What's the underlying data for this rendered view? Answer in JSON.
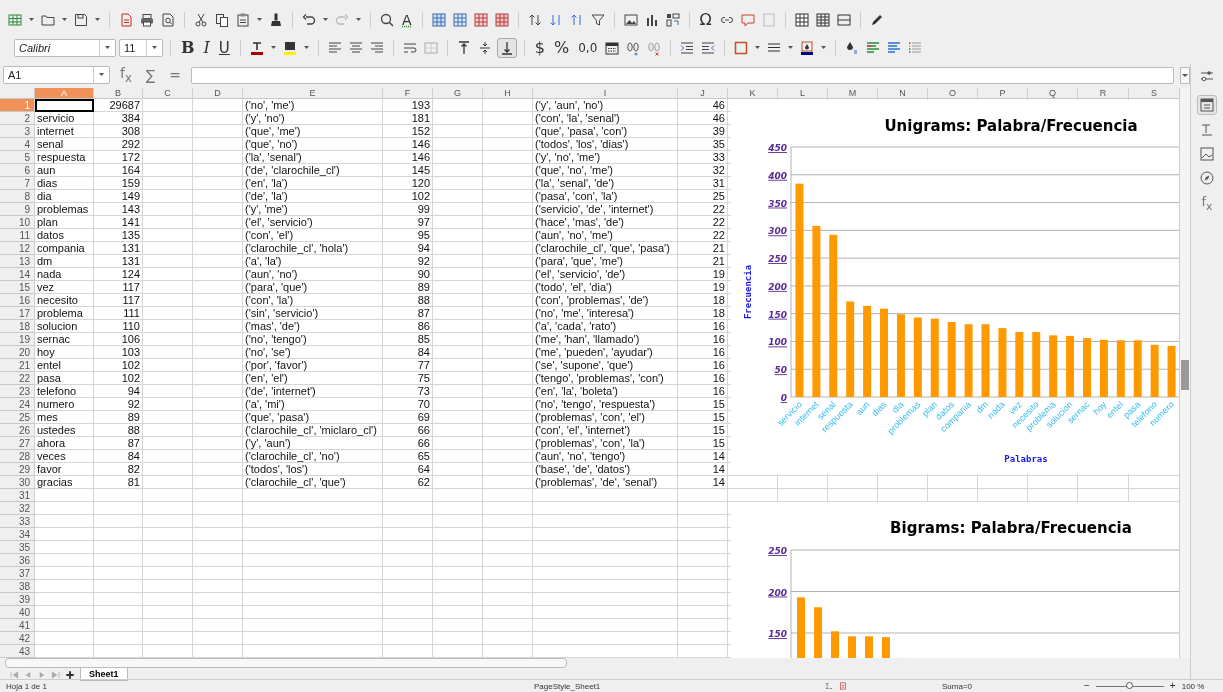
{
  "toolbar": {
    "spelling": "A",
    "special_character": "Ω",
    "font_name": "Calibri",
    "font_size": "11",
    "bold": "B",
    "italic": "I",
    "underline": "U",
    "align_bottom_on": true,
    "currency": "$",
    "percent": "%",
    "number_format": "0,0"
  },
  "formula_bar": {
    "name_box": "A1",
    "function_wizard": "f$_{x}$",
    "sum": "∑",
    "equals": "="
  },
  "columns": [
    {
      "label": "A",
      "selected": true
    },
    {
      "label": "B",
      "selected": false
    },
    {
      "label": "C",
      "selected": false
    },
    {
      "label": "D",
      "selected": false
    },
    {
      "label": "E",
      "selected": false
    },
    {
      "label": "F",
      "selected": false
    },
    {
      "label": "G",
      "selected": false
    },
    {
      "label": "H",
      "selected": false
    },
    {
      "label": "I",
      "selected": false
    },
    {
      "label": "J",
      "selected": false
    },
    {
      "label": "K",
      "selected": false
    },
    {
      "label": "L",
      "selected": false
    },
    {
      "label": "M",
      "selected": false
    },
    {
      "label": "N",
      "selected": false
    },
    {
      "label": "O",
      "selected": false
    },
    {
      "label": "P",
      "selected": false
    },
    {
      "label": "Q",
      "selected": false
    },
    {
      "label": "R",
      "selected": false
    },
    {
      "label": "S",
      "selected": false
    }
  ],
  "rows": [
    {
      "number": "1",
      "selected": true,
      "cells": [
        null,
        "29687",
        null,
        null,
        "('no', 'me')",
        "193",
        null,
        null,
        "('y', 'aun', 'no')",
        "46"
      ]
    },
    {
      "number": "2",
      "selected": false,
      "cells": [
        "servicio",
        "384",
        null,
        null,
        "('y', 'no')",
        "181",
        null,
        null,
        "('con', 'la', 'senal')",
        "46"
      ]
    },
    {
      "number": "3",
      "selected": false,
      "cells": [
        "internet",
        "308",
        null,
        null,
        "('que', 'me')",
        "152",
        null,
        null,
        "('que', 'pasa', 'con')",
        "39"
      ]
    },
    {
      "number": "4",
      "selected": false,
      "cells": [
        "senal",
        "292",
        null,
        null,
        "('que', 'no')",
        "146",
        null,
        null,
        "('todos', 'los', 'dias')",
        "35"
      ]
    },
    {
      "number": "5",
      "selected": false,
      "cells": [
        "respuesta",
        "172",
        null,
        null,
        "('la', 'senal')",
        "146",
        null,
        null,
        "('y', 'no', 'me')",
        "33"
      ]
    },
    {
      "number": "6",
      "selected": false,
      "cells": [
        "aun",
        "164",
        null,
        null,
        "('de', 'clarochile_cl')",
        "145",
        null,
        null,
        "('que', 'no', 'me')",
        "32"
      ]
    },
    {
      "number": "7",
      "selected": false,
      "cells": [
        "dias",
        "159",
        null,
        null,
        "('en', 'la')",
        "120",
        null,
        null,
        "('la', 'senal', 'de')",
        "31"
      ]
    },
    {
      "number": "8",
      "selected": false,
      "cells": [
        "dia",
        "149",
        null,
        null,
        "('de', 'la')",
        "102",
        null,
        null,
        "('pasa', 'con', 'la')",
        "25"
      ]
    },
    {
      "number": "9",
      "selected": false,
      "cells": [
        "problemas",
        "143",
        null,
        null,
        "('y', 'me')",
        "99",
        null,
        null,
        "('servicio', 'de', 'internet')",
        "22"
      ]
    },
    {
      "number": "10",
      "selected": false,
      "cells": [
        "plan",
        "141",
        null,
        null,
        "('el', 'servicio')",
        "97",
        null,
        null,
        "('hace', 'mas', 'de')",
        "22"
      ]
    },
    {
      "number": "11",
      "selected": false,
      "cells": [
        "datos",
        "135",
        null,
        null,
        "('con', 'el')",
        "95",
        null,
        null,
        "('aun', 'no', 'me')",
        "22"
      ]
    },
    {
      "number": "12",
      "selected": false,
      "cells": [
        "compania",
        "131",
        null,
        null,
        "('clarochile_cl', 'hola')",
        "94",
        null,
        null,
        "('clarochile_cl', 'que', 'pasa')",
        "21"
      ]
    },
    {
      "number": "13",
      "selected": false,
      "cells": [
        "dm",
        "131",
        null,
        null,
        "('a', 'la')",
        "92",
        null,
        null,
        "('para', 'que', 'me')",
        "21"
      ]
    },
    {
      "number": "14",
      "selected": false,
      "cells": [
        "nada",
        "124",
        null,
        null,
        "('aun', 'no')",
        "90",
        null,
        null,
        "('el', 'servicio', 'de')",
        "19"
      ]
    },
    {
      "number": "15",
      "selected": false,
      "cells": [
        "vez",
        "117",
        null,
        null,
        "('para', 'que')",
        "89",
        null,
        null,
        "('todo', 'el', 'dia')",
        "19"
      ]
    },
    {
      "number": "16",
      "selected": false,
      "cells": [
        "necesito",
        "117",
        null,
        null,
        "('con', 'la')",
        "88",
        null,
        null,
        "('con', 'problemas', 'de')",
        "18"
      ]
    },
    {
      "number": "17",
      "selected": false,
      "cells": [
        "problema",
        "111",
        null,
        null,
        "('sin', 'servicio')",
        "87",
        null,
        null,
        "('no', 'me', 'interesa')",
        "18"
      ]
    },
    {
      "number": "18",
      "selected": false,
      "cells": [
        "solucion",
        "110",
        null,
        null,
        "('mas', 'de')",
        "86",
        null,
        null,
        "('a', 'cada', 'rato')",
        "16"
      ]
    },
    {
      "number": "19",
      "selected": false,
      "cells": [
        "sernac",
        "106",
        null,
        null,
        "('no', 'tengo')",
        "85",
        null,
        null,
        "('me', 'han', 'llamado')",
        "16"
      ]
    },
    {
      "number": "20",
      "selected": false,
      "cells": [
        "hoy",
        "103",
        null,
        null,
        "('no', 'se')",
        "84",
        null,
        null,
        "('me', 'pueden', 'ayudar')",
        "16"
      ]
    },
    {
      "number": "21",
      "selected": false,
      "cells": [
        "entel",
        "102",
        null,
        null,
        "('por', 'favor')",
        "77",
        null,
        null,
        "('se', 'supone', 'que')",
        "16"
      ]
    },
    {
      "number": "22",
      "selected": false,
      "cells": [
        "pasa",
        "102",
        null,
        null,
        "('en', 'el')",
        "75",
        null,
        null,
        "('tengo', 'problemas', 'con')",
        "16"
      ]
    },
    {
      "number": "23",
      "selected": false,
      "cells": [
        "telefono",
        "94",
        null,
        null,
        "('de', 'internet')",
        "73",
        null,
        null,
        "('en', 'la', 'boleta')",
        "16"
      ]
    },
    {
      "number": "24",
      "selected": false,
      "cells": [
        "numero",
        "92",
        null,
        null,
        "('a', 'mi')",
        "70",
        null,
        null,
        "('no', 'tengo', 'respuesta')",
        "15"
      ]
    },
    {
      "number": "25",
      "selected": false,
      "cells": [
        "mes",
        "89",
        null,
        null,
        "('que', 'pasa')",
        "69",
        null,
        null,
        "('problemas', 'con', 'el')",
        "15"
      ]
    },
    {
      "number": "26",
      "selected": false,
      "cells": [
        "ustedes",
        "88",
        null,
        null,
        "('clarochile_cl', 'miclaro_cl')",
        "66",
        null,
        null,
        "('con', 'el', 'internet')",
        "15"
      ]
    },
    {
      "number": "27",
      "selected": false,
      "cells": [
        "ahora",
        "87",
        null,
        null,
        "('y', 'aun')",
        "66",
        null,
        null,
        "('problemas', 'con', 'la')",
        "15"
      ]
    },
    {
      "number": "28",
      "selected": false,
      "cells": [
        "veces",
        "84",
        null,
        null,
        "('clarochile_cl', 'no')",
        "65",
        null,
        null,
        "('aun', 'no', 'tengo')",
        "14"
      ]
    },
    {
      "number": "29",
      "selected": false,
      "cells": [
        "favor",
        "82",
        null,
        null,
        "('todos', 'los')",
        "64",
        null,
        null,
        "('base', 'de', 'datos')",
        "14"
      ]
    },
    {
      "number": "30",
      "selected": false,
      "cells": [
        "gracias",
        "81",
        null,
        null,
        "('clarochile_cl', 'que')",
        "62",
        null,
        null,
        "('problemas', 'de', 'senal')",
        "14"
      ]
    },
    {
      "number": "31",
      "selected": false
    },
    {
      "number": "32",
      "selected": false
    },
    {
      "number": "33",
      "selected": false
    },
    {
      "number": "34",
      "selected": false
    },
    {
      "number": "35",
      "selected": false
    },
    {
      "number": "36",
      "selected": false
    },
    {
      "number": "37",
      "selected": false
    },
    {
      "number": "38",
      "selected": false
    },
    {
      "number": "39",
      "selected": false
    },
    {
      "number": "40",
      "selected": false
    },
    {
      "number": "41",
      "selected": false
    },
    {
      "number": "42",
      "selected": false
    },
    {
      "number": "43",
      "selected": false
    }
  ],
  "charts": [
    {
      "chart_data": {
        "type": "bar",
        "title": "Unigrams: Palabra/Frecuencia",
        "xlabel": "Palabras",
        "ylabel": "Frecuencia",
        "categories": [
          "servicio",
          "internet",
          "senal",
          "respuesta",
          "aun",
          "dias",
          "dia",
          "problemas",
          "plan",
          "datos",
          "compania",
          "dm",
          "nada",
          "vez",
          "necesito",
          "problema",
          "solucion",
          "sernac",
          "hoy",
          "entel",
          "pasa",
          "telefono",
          "numero"
        ],
        "values": [
          384,
          308,
          292,
          172,
          164,
          159,
          149,
          143,
          141,
          135,
          131,
          131,
          124,
          117,
          117,
          111,
          110,
          106,
          103,
          102,
          102,
          94,
          92
        ],
        "ylim": [
          0,
          450
        ],
        "yticks": [
          0,
          50,
          100,
          150,
          200,
          250,
          300,
          350,
          400,
          450
        ],
        "grid": true
      }
    },
    {
      "title": "Bigrams: Palabra/Frecuencia",
      "scale_marks": [
        "250",
        "200",
        "150"
      ]
    }
  ],
  "sidebar": {
    "functions": "f$_{x}$"
  },
  "sheet_tabs": [
    {
      "label": "Sheet1",
      "selected": true
    }
  ],
  "status_bar": {
    "sheet": "Hoja 1 de 1",
    "page_style": "PageStyle_Sheet1",
    "sum": "Suma=0",
    "zoom_out": "−",
    "zoom_slider": {
      "level": 0.5
    },
    "zoom_in": "+",
    "zoom": "100 %"
  }
}
